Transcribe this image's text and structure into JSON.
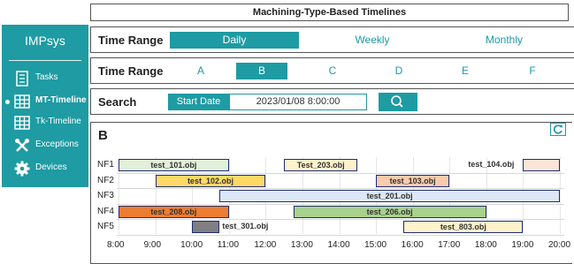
{
  "header": {
    "title": "Machining-Type-Based Timelines"
  },
  "sidebar": {
    "app_name": "IMPsys",
    "items": [
      {
        "label": "Tasks",
        "icon": "tasks-icon"
      },
      {
        "label": "MT-Timeline",
        "icon": "grid-icon",
        "active": true
      },
      {
        "label": "Tk-Timeline",
        "icon": "grid-icon"
      },
      {
        "label": "Exceptions",
        "icon": "tools-icon"
      },
      {
        "label": "Devices",
        "icon": "gear-icon"
      }
    ]
  },
  "time_range_1": {
    "label": "Time Range",
    "options": [
      "Daily",
      "Weekly",
      "Monthly"
    ],
    "selected": "Daily"
  },
  "time_range_2": {
    "label": "Time Range",
    "options": [
      "A",
      "B",
      "C",
      "D",
      "E",
      "F"
    ],
    "selected": "B"
  },
  "search": {
    "label": "Search",
    "date_label": "Start Date",
    "date_value": "2023/01/08 8:00:00",
    "button_icon": "search-icon"
  },
  "panel": {
    "title": "B",
    "refresh_icon": "refresh-icon"
  },
  "timeline": {
    "rows": [
      "NF1",
      "NF2",
      "NF3",
      "NF4",
      "NF5"
    ],
    "axis_labels": [
      "8:00",
      "9:00",
      "10:00",
      "11:00",
      "12:00",
      "13:00",
      "14:00",
      "15:00",
      "16:00",
      "17:00",
      "18:00",
      "19:00",
      "20:00"
    ],
    "tasks": [
      {
        "row": "NF1",
        "label": "test_101.obj",
        "start": "8:00",
        "end": "11:00",
        "color": "#e2efda"
      },
      {
        "row": "NF1",
        "label": "Test_203.obj",
        "start": "12:30",
        "end": "14:30",
        "color": "#fff2cc"
      },
      {
        "row": "NF1",
        "label": "test_104.obj",
        "start": "19:00",
        "end": "20:00",
        "color": "#fce4d6"
      },
      {
        "row": "NF2",
        "label": "test_102.obj",
        "start": "9:00",
        "end": "12:00",
        "color": "#ffd966"
      },
      {
        "row": "NF2",
        "label": "test_103.obj",
        "start": "15:00",
        "end": "17:00",
        "color": "#f8cbad"
      },
      {
        "row": "NF3",
        "label": "test_201.obj",
        "start": "10:45",
        "end": "20:00",
        "color": "#dde7f5"
      },
      {
        "row": "NF4",
        "label": "test_208.obj",
        "start": "8:00",
        "end": "11:00",
        "color": "#ed7d31"
      },
      {
        "row": "NF4",
        "label": "test_206.obj",
        "start": "12:45",
        "end": "18:00",
        "color": "#a9d18e"
      },
      {
        "row": "NF5",
        "label": "test_301.obj",
        "start": "10:00",
        "end": "10:45",
        "color": "#808080"
      },
      {
        "row": "NF5",
        "label": "test_803.obj",
        "start": "15:45",
        "end": "19:00",
        "color": "#fff2cc"
      }
    ]
  }
}
